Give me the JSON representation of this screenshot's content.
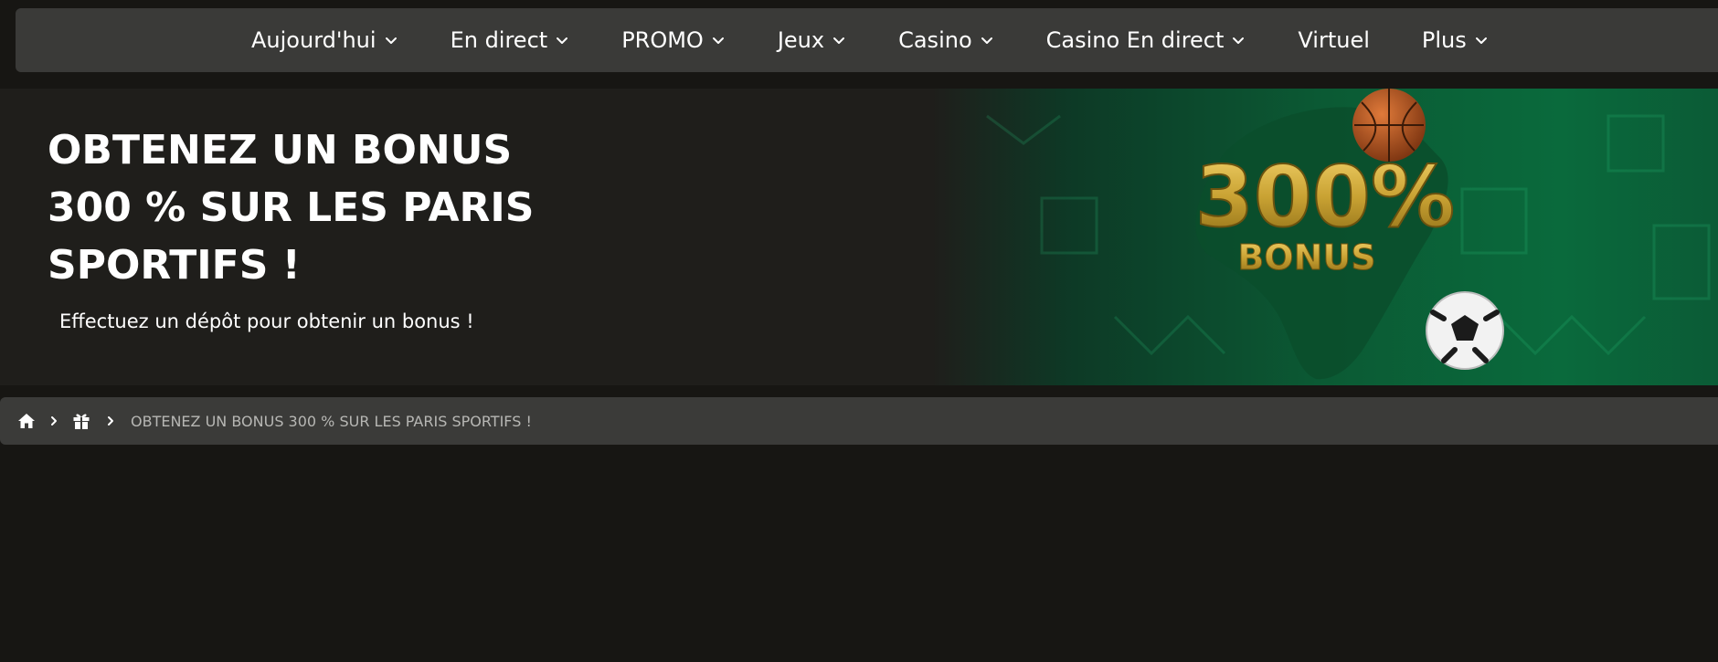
{
  "nav": {
    "items": [
      {
        "label": "Aujourd'hui",
        "has_dropdown": true,
        "icon": "chevron-down-icon"
      },
      {
        "label": "En direct",
        "has_dropdown": true,
        "icon": "chevron-down-icon"
      },
      {
        "label": "PROMO",
        "has_dropdown": true,
        "icon": "chevron-down-icon"
      },
      {
        "label": "Jeux",
        "has_dropdown": true,
        "icon": "chevron-down-icon"
      },
      {
        "label": "Casino",
        "has_dropdown": true,
        "icon": "chevron-down-icon"
      },
      {
        "label": "Casino En direct",
        "has_dropdown": true,
        "icon": "chevron-down-icon"
      },
      {
        "label": "Virtuel",
        "has_dropdown": false
      },
      {
        "label": "Plus",
        "has_dropdown": true,
        "icon": "chevron-down-icon"
      }
    ]
  },
  "banner": {
    "title": "OBTENEZ UN BONUS 300 % SUR LES PARIS SPORTIFS !",
    "subtitle": "Effectuez un dépôt pour obtenir un bonus !",
    "image": {
      "big_text": "300%",
      "bonus_text": "BONUS",
      "icons": [
        "basketball-icon",
        "soccer-ball-icon",
        "africa-map-icon"
      ]
    }
  },
  "breadcrumb": {
    "icons": [
      "home-icon",
      "gift-icon"
    ],
    "current": "OBTENEZ UN BONUS 300 % SUR LES PARIS SPORTIFS !"
  },
  "colors": {
    "background": "#171613",
    "nav_bg": "#3a3a38",
    "banner_bg": "#1f1e1b",
    "banner_green": "#0b5a34",
    "gold": "#c9a233",
    "breadcrumb_bg": "#3b3b39"
  }
}
